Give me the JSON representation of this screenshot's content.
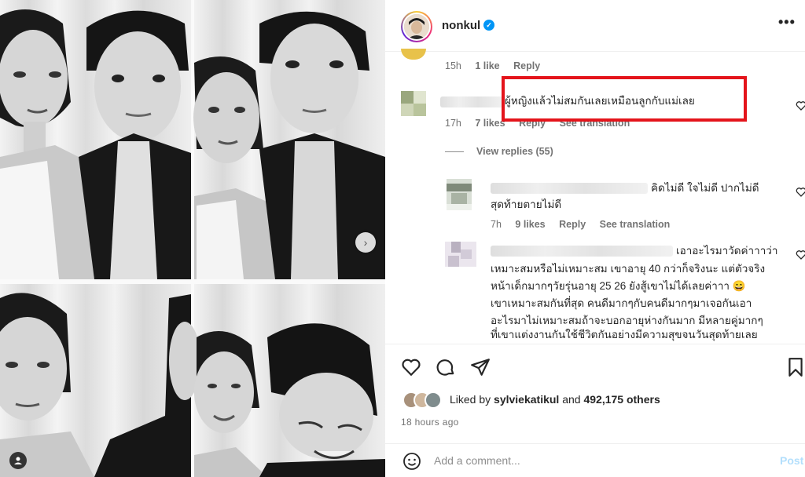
{
  "post": {
    "username": "nonkul",
    "verified": true,
    "more_label": "•••"
  },
  "comments": [
    {
      "text": "",
      "time": "15h",
      "likes": "1 like",
      "reply": "Reply"
    },
    {
      "text": "ผู้หญิงแล้วไม่สมกันเลยเหมือนลูกกับแม่เลย",
      "time": "17h",
      "likes": "7 likes",
      "reply": "Reply",
      "translate": "See translation",
      "view_replies": "View replies (55)"
    }
  ],
  "replies": [
    {
      "lines": [
        "คิดไม่ดี ใจไม่ดี ปากไม่ดี",
        "สุดท้ายตายไม่ดี"
      ],
      "time": "7h",
      "likes": "9 likes",
      "reply": "Reply",
      "translate": "See translation"
    },
    {
      "lines": [
        "เอาอะไรมาวัดค่าาาว่า",
        "เหมาะสมหรือไม่เหมาะสม เขาอายุ 40 กว่าก็จริงนะ แต่ตัวจริง",
        "หน้าเด็กมากๆวัยรุ่นอายุ 25 26 ยังสู้เขาไม่ได้เลยค่าาา 😄",
        "เขาเหมาะสมกันที่สุด คนดีมากๆกับคนดีมากๆมาเจอกันเอา",
        "อะไรมาไม่เหมาะสมถ้าจะบอกอายุห่างกันมาก มีหลายคู่มากๆ",
        "ที่เขาแต่งงานกันใช้ชีวิตกันอย่างมีความสุขจนวันสุดท้ายเลย"
      ]
    }
  ],
  "engagement": {
    "liked_prefix": "Liked by",
    "liked_user": "sylviekatikul",
    "liked_and": "and",
    "liked_others": "492,175 others",
    "time_ago": "18 hours ago"
  },
  "comment_box": {
    "placeholder": "Add a comment...",
    "post_label": "Post"
  },
  "colors": {
    "highlight": "#e4141b",
    "verified": "#0095f6",
    "post_disabled": "#b3dffc"
  }
}
